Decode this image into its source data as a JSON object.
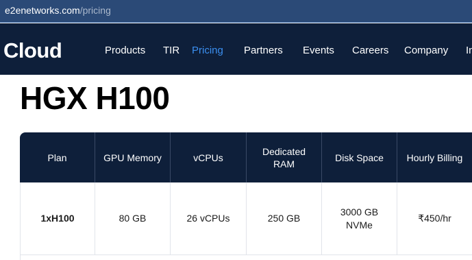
{
  "browser": {
    "url_host": "e2enetworks.com",
    "url_path": "/pricing"
  },
  "nav": {
    "logo": "Cloud",
    "items": [
      "Products",
      "TIR",
      "Pricing",
      "Partners",
      "Events",
      "Careers",
      "Company",
      "In"
    ],
    "active": "Pricing"
  },
  "page": {
    "title": "HGX H100"
  },
  "table": {
    "headers": [
      "Plan",
      "GPU Memory",
      "vCPUs",
      "Dedicated RAM",
      "Disk Space",
      "Hourly Billing"
    ],
    "rows": [
      [
        "1xH100",
        "80 GB",
        "26 vCPUs",
        "250 GB",
        "3000 GB NVMe",
        "₹450/hr"
      ]
    ]
  }
}
